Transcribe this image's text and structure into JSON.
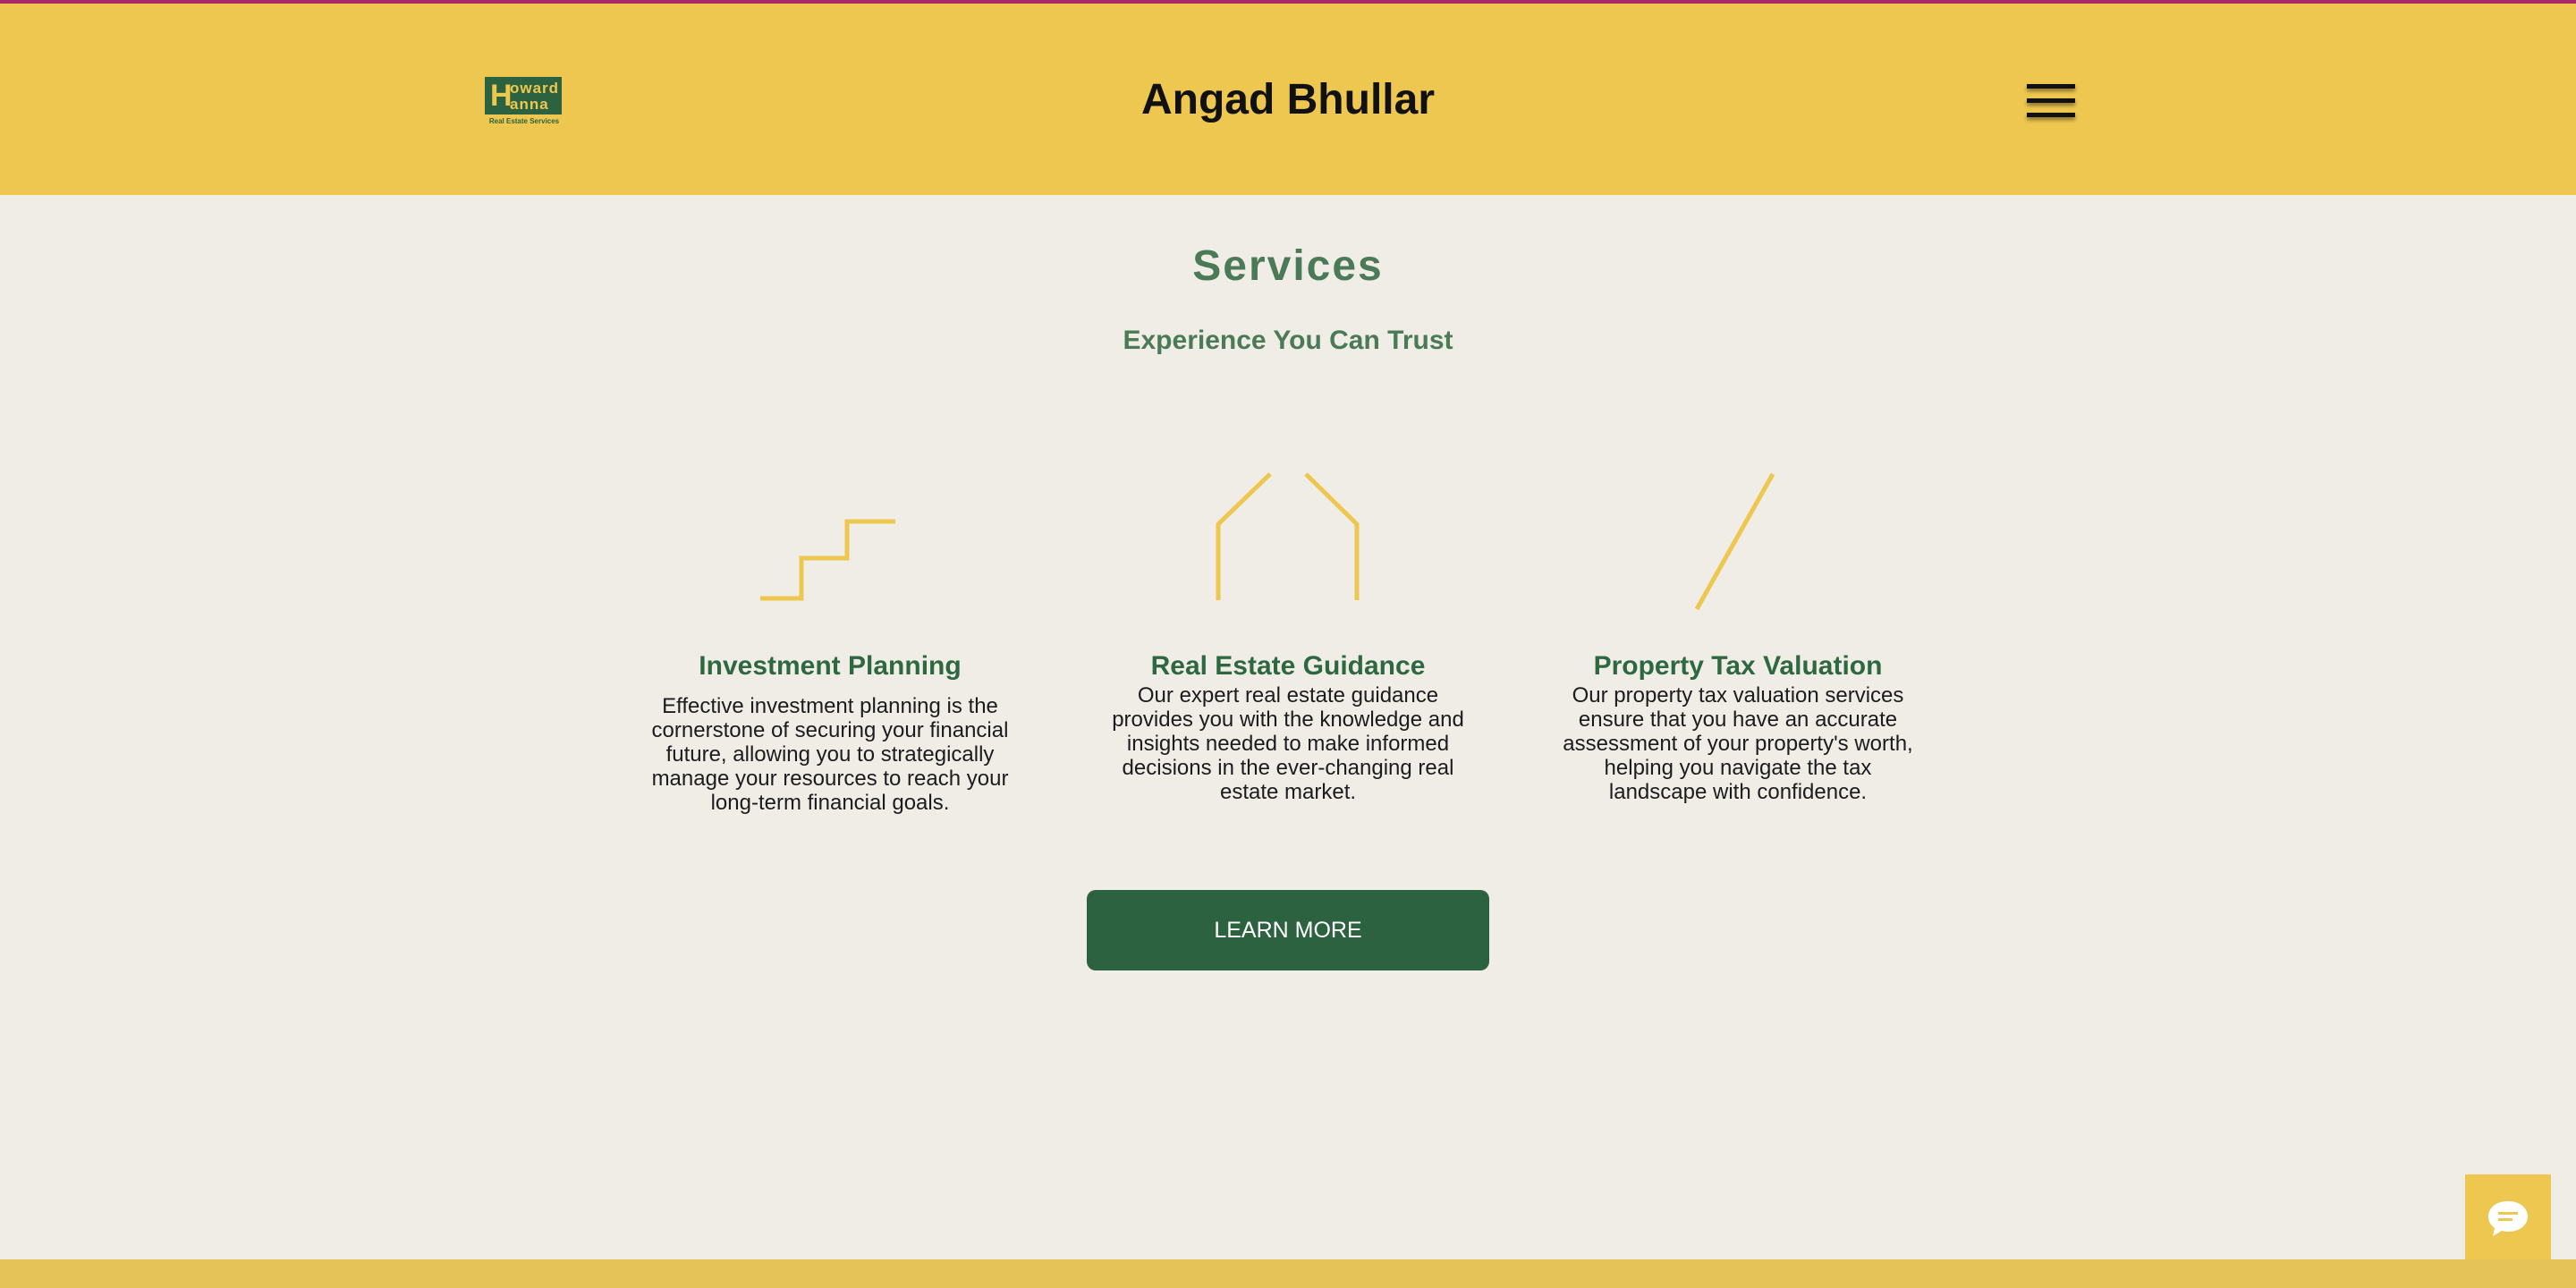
{
  "header": {
    "logo": {
      "h": "H",
      "word_top": "oward",
      "word_bottom": "anna",
      "subtext": "Real Estate Services"
    },
    "site_title": "Angad Bhullar",
    "menu_icon": "hamburger-menu-icon"
  },
  "section": {
    "title": "Services",
    "subtitle": "Experience You Can Trust"
  },
  "services": [
    {
      "icon": "stairs-icon",
      "title": "Investment Planning",
      "description": "Effective investment planning is the cornerstone of securing your financial future, allowing you to strategically manage your resources to reach your long-term financial goals."
    },
    {
      "icon": "house-outline-icon",
      "title": "Real Estate Guidance",
      "description": "Our expert real estate guidance provides you with the knowledge and insights needed to make informed decisions in the ever-changing real estate market."
    },
    {
      "icon": "slash-line-icon",
      "title": "Property Tax Valuation",
      "description": "Our property tax valuation services ensure that you have an accurate assessment of your property's worth, helping you navigate the tax landscape with confidence."
    }
  ],
  "cta": {
    "label": "LEARN MORE"
  },
  "chat": {
    "icon": "chat-bubble-icon"
  },
  "colors": {
    "header_bg": "#edc74f",
    "page_bg": "#f0ede6",
    "accent_green": "#2d6240",
    "heading_green": "#4b7a57",
    "icon_yellow": "#edc74f",
    "top_line": "#a8286a"
  }
}
